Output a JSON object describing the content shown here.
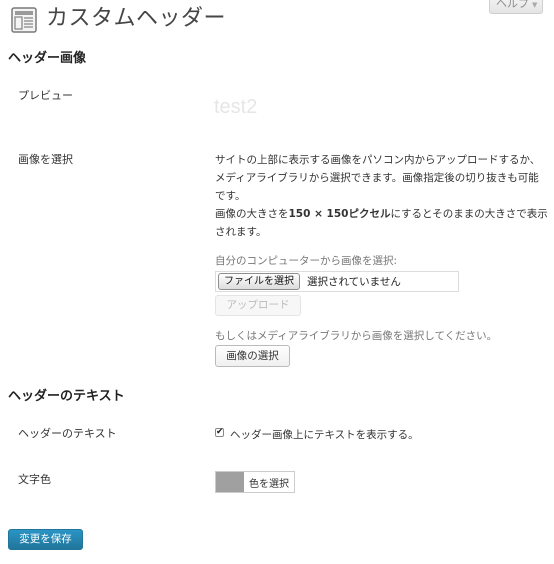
{
  "header": {
    "icon": "custom-header-icon",
    "title": "カスタムヘッダー",
    "help_label": "ヘルプ",
    "help_caret": "▼"
  },
  "header_image_section": {
    "heading": "ヘッダー画像",
    "preview_label": "プレビュー",
    "preview_text": "test2",
    "select_label": "画像を選択",
    "description_line1": "サイトの上部に表示する画像をパソコン内からアップロードするか、メディアライブラリから選択できます。画像指定後の切り抜きも可能です。",
    "description_line2_prefix": "画像の大きさを",
    "description_size": "150 × 150ピクセル",
    "description_line2_suffix": "にするとそのままの大きさで表示されます。",
    "upload_label": "自分のコンピューターから画像を選択:",
    "file_button": "ファイルを選択",
    "file_status": "選択されていません",
    "upload_button": "アップロード",
    "library_label": "もしくはメディアライブラリから画像を選択してください。",
    "library_button": "画像の選択"
  },
  "header_text_section": {
    "heading": "ヘッダーのテキスト",
    "text_row_label": "ヘッダーのテキスト",
    "show_text_checked": true,
    "checkbox_mark": "✔",
    "show_text_label": "ヘッダー画像上にテキストを表示する。",
    "color_row_label": "文字色",
    "color_swatch": "#a0a0a0",
    "color_button": "色を選択"
  },
  "footer": {
    "save_button": "変更を保存"
  }
}
